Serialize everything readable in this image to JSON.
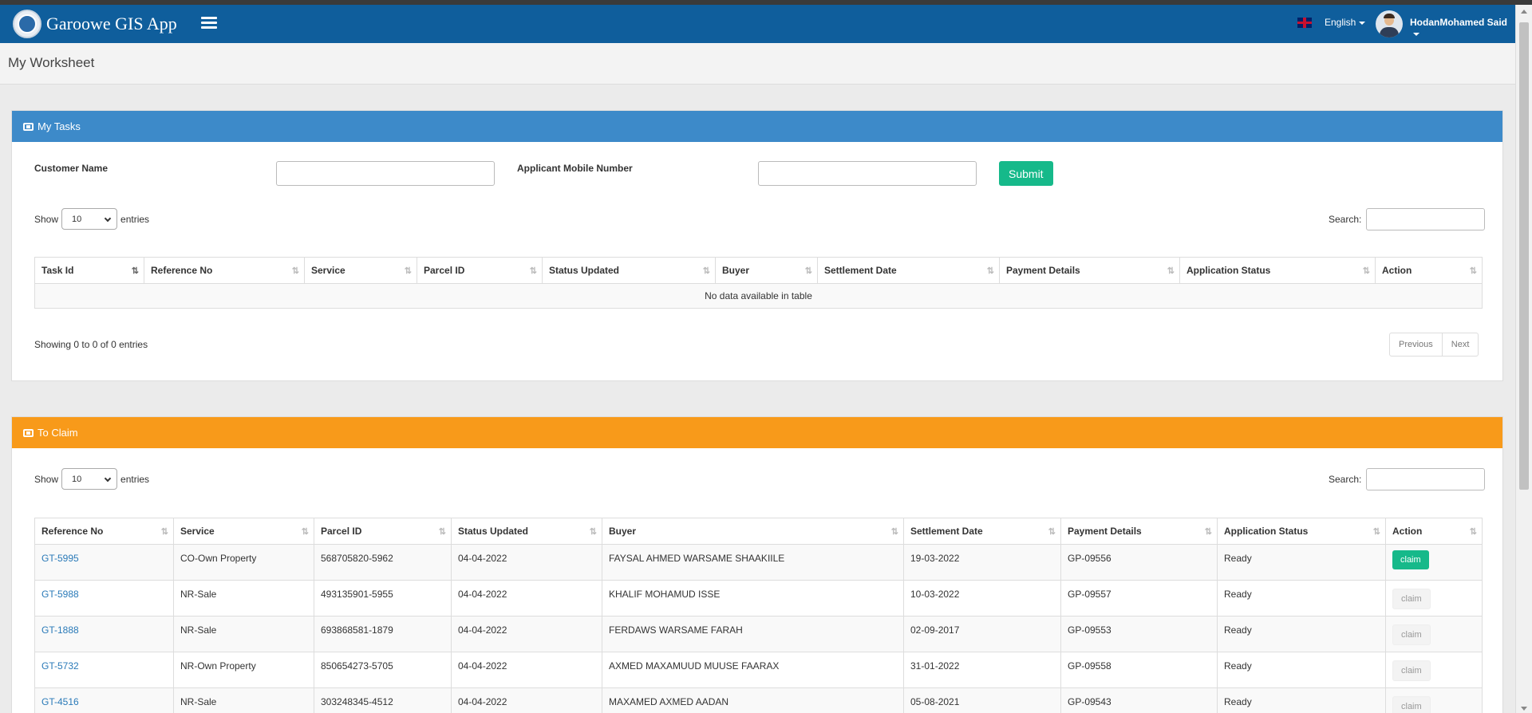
{
  "app": {
    "title": "Garoowe GIS App",
    "language": "English",
    "user": "HodanMohamed Said"
  },
  "page": {
    "title": "My Worksheet"
  },
  "my_tasks": {
    "title": "My Tasks",
    "customer_name_label": "Customer Name",
    "mobile_label": "Applicant Mobile Number",
    "submit_label": "Submit",
    "show_label": "Show",
    "entries_value": "10",
    "entries_label": "entries",
    "search_label": "Search:",
    "columns": [
      "Task Id",
      "Reference No",
      "Service",
      "Parcel ID",
      "Status Updated",
      "Buyer",
      "Settlement Date",
      "Payment Details",
      "Application Status",
      "Action"
    ],
    "empty_message": "No data available in table",
    "info": "Showing 0 to 0 of 0 entries",
    "previous": "Previous",
    "next": "Next"
  },
  "to_claim": {
    "title": "To Claim",
    "show_label": "Show",
    "entries_value": "10",
    "entries_label": "entries",
    "search_label": "Search:",
    "columns": [
      "Reference No",
      "Service",
      "Parcel ID",
      "Status Updated",
      "Buyer",
      "Settlement Date",
      "Payment Details",
      "Application Status",
      "Action"
    ],
    "rows": [
      {
        "ref": "GT-5995",
        "service": "CO-Own Property",
        "parcel": "568705820-5962",
        "updated": "04-04-2022",
        "buyer": "FAYSAL AHMED WARSAME SHAAKIILE",
        "settlement": "19-03-2022",
        "payment": "GP-09556",
        "status": "Ready",
        "action": "claim",
        "action_enabled": true
      },
      {
        "ref": "GT-5988",
        "service": "NR-Sale",
        "parcel": "493135901-5955",
        "updated": "04-04-2022",
        "buyer": "KHALIF MOHAMUD ISSE",
        "settlement": "10-03-2022",
        "payment": "GP-09557",
        "status": "Ready",
        "action": "claim",
        "action_enabled": false
      },
      {
        "ref": "GT-1888",
        "service": "NR-Sale",
        "parcel": "693868581-1879",
        "updated": "04-04-2022",
        "buyer": "FERDAWS WARSAME FARAH",
        "settlement": "02-09-2017",
        "payment": "GP-09553",
        "status": "Ready",
        "action": "claim",
        "action_enabled": false
      },
      {
        "ref": "GT-5732",
        "service": "NR-Own Property",
        "parcel": "850654273-5705",
        "updated": "04-04-2022",
        "buyer": "AXMED MAXAMUUD MUUSE FAARAX",
        "settlement": "31-01-2022",
        "payment": "GP-09558",
        "status": "Ready",
        "action": "claim",
        "action_enabled": false
      },
      {
        "ref": "GT-4516",
        "service": "NR-Sale",
        "parcel": "303248345-4512",
        "updated": "04-04-2022",
        "buyer": "MAXAMED AXMED AADAN",
        "settlement": "05-08-2021",
        "payment": "GP-09543",
        "status": "Ready",
        "action": "claim",
        "action_enabled": false
      }
    ]
  },
  "colors": {
    "navbar": "#0f5e9c",
    "panel_blue": "#3d8ac9",
    "panel_orange": "#f89a1a",
    "button_green": "#16b98a",
    "link": "#2a7ab8"
  }
}
